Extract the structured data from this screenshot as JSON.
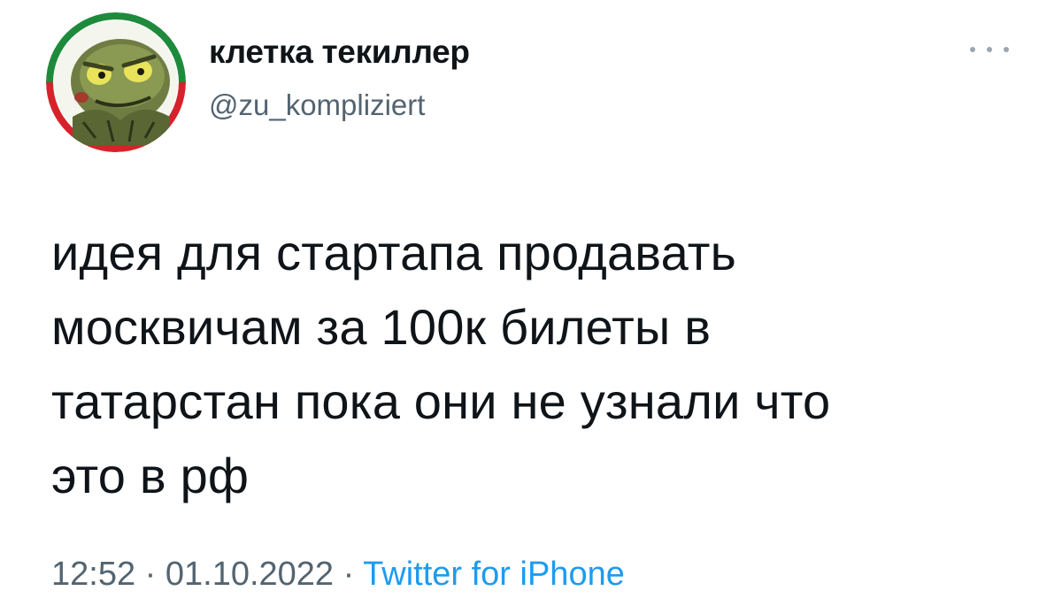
{
  "author": {
    "display_name": "клетка текиллер",
    "handle": "@zu_kompliziert",
    "avatar_icon": "cartoon-goblin-avatar-icon"
  },
  "more_menu_icon": "more-dots-icon",
  "tweet": {
    "lines": [
      "идея для стартапа продавать",
      "москвичам за 100к билеты в",
      "татарстан пока они не узнали что",
      "это в рф"
    ]
  },
  "meta": {
    "time": "12:52",
    "date": "01.10.2022",
    "separator": "·",
    "source": "Twitter for iPhone"
  },
  "colors": {
    "text_primary": "#0f1419",
    "text_secondary": "#536471",
    "link": "#1d9bf0",
    "avatar_ring_red": "#d6232b",
    "avatar_ring_green": "#1e8a3c"
  }
}
